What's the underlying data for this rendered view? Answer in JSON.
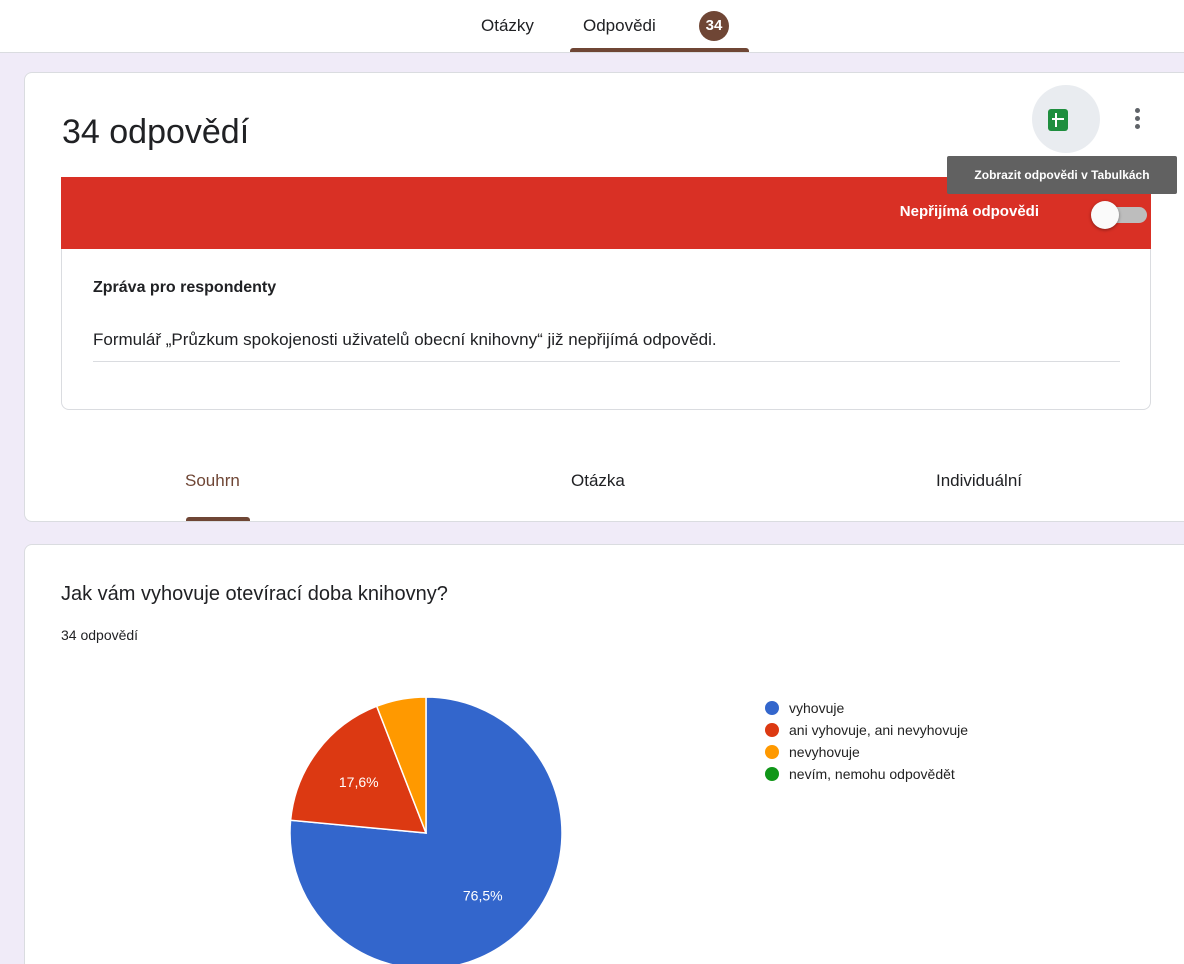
{
  "topnav": {
    "tabs": [
      {
        "label": "Otázky"
      },
      {
        "label": "Odpovědi",
        "badge": "34"
      }
    ],
    "active_color": "#6f4635"
  },
  "summary": {
    "title": "34 odpovědí",
    "sheets_icon": "sheets-icon",
    "more_icon": "more-vert-icon",
    "tooltip": "Zobrazit odpovědi v Tabulkách"
  },
  "accepting": {
    "label": "Nepřijímá odpovědi",
    "enabled": false,
    "bar_color": "#d93025"
  },
  "message": {
    "title": "Zpráva pro respondenty",
    "text": "Formulář „Průzkum spokojenosti uživatelů obecní knihovny“ již nepřijímá odpovědi."
  },
  "subtabs": [
    {
      "label": "Souhrn",
      "active": true
    },
    {
      "label": "Otázka"
    },
    {
      "label": "Individuální"
    }
  ],
  "question": {
    "title": "Jak vám vyhovuje otevírací doba knihovny?",
    "count": "34 odpovědí"
  },
  "chart_data": {
    "type": "pie",
    "categories": [
      "vyhovuje",
      "ani vyhovuje, ani nevyhovuje",
      "nevyhovuje",
      "nevím, nemohu odpovědět"
    ],
    "values": [
      76.5,
      17.6,
      5.9,
      0
    ],
    "data_labels": [
      "76,5%",
      "17,6%",
      "",
      ""
    ],
    "colors": [
      "#3366cc",
      "#dc3912",
      "#ff9900",
      "#109618"
    ],
    "legend": "right"
  }
}
